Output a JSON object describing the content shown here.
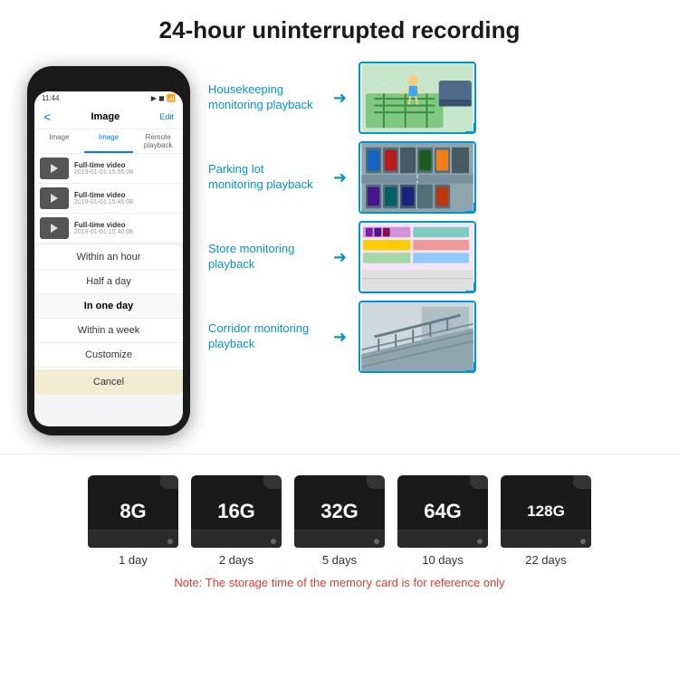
{
  "title": "24-hour uninterrupted recording",
  "phone": {
    "time": "11:44",
    "nav": {
      "back": "<",
      "title": "Image",
      "edit": "Edit"
    },
    "tabs": [
      "Image",
      "Image",
      "Remote playback"
    ],
    "videos": [
      {
        "title": "Full-time video",
        "date": "2019-01-01 15:55:08"
      },
      {
        "title": "Full-time video",
        "date": "2019-01-01 15:45:08"
      },
      {
        "title": "Full-time video",
        "date": "2019-01-01 15:40:08"
      }
    ],
    "dropdown_items": [
      "Within an hour",
      "Half a day",
      "In one day",
      "Within a week",
      "Customize"
    ],
    "cancel_label": "Cancel"
  },
  "monitoring": [
    {
      "label": "Housekeeping monitoring playback",
      "photo_desc": "Child playing on mat"
    },
    {
      "label": "Parking lot monitoring playback",
      "photo_desc": "Aerial parking lot view"
    },
    {
      "label": "Store monitoring playback",
      "photo_desc": "Store interior with person"
    },
    {
      "label": "Corridor monitoring playback",
      "photo_desc": "Corridor stairs view"
    }
  ],
  "storage_cards": [
    {
      "size": "8G",
      "days": "1 day"
    },
    {
      "size": "16G",
      "days": "2 days"
    },
    {
      "size": "32G",
      "days": "5 days"
    },
    {
      "size": "64G",
      "days": "10 days"
    },
    {
      "size": "128G",
      "days": "22 days"
    }
  ],
  "storage_note": "Note: The storage time of the memory card is for reference only",
  "colors": {
    "accent": "#0096cc",
    "note_red": "#e53935"
  }
}
